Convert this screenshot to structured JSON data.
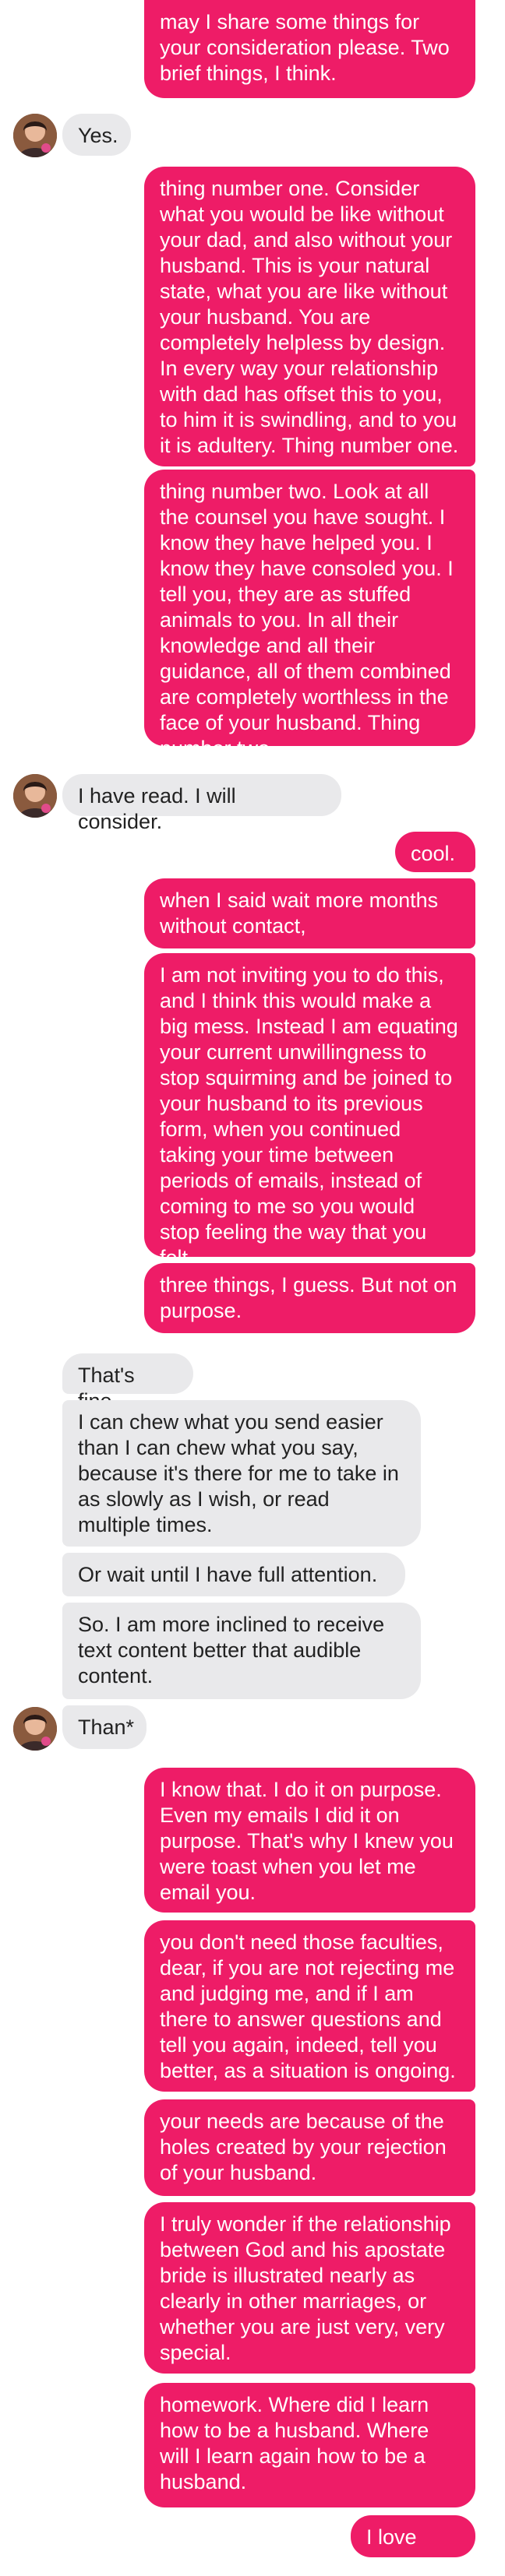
{
  "colors": {
    "outgoing_bubble": "#ee1c67",
    "outgoing_text": "#ffffff",
    "incoming_bubble": "#e9e9eb",
    "incoming_text": "#222222"
  },
  "avatar_icon": "profile-photo",
  "messages": [
    {
      "from": "me",
      "text": "may I share some things for your consideration please. Two brief things, I think."
    },
    {
      "from": "them",
      "text": "Yes."
    },
    {
      "from": "me",
      "text": "thing number one. Consider what you would be like without your dad, and also without your husband. This is your natural state, what you are like without your husband. You are completely helpless by design. In every way your relationship with dad has offset this to you, to him it is swindling, and to you it is adultery. Thing number one."
    },
    {
      "from": "me",
      "text": "thing number two. Look at all the counsel you have sought. I know they have helped you. I know they have consoled you. I tell you, they are as stuffed animals to you. In all their knowledge and all their guidance, all of them combined are completely worthless in the face of your husband. Thing number two."
    },
    {
      "from": "them",
      "text": "I have read. I will consider."
    },
    {
      "from": "me",
      "text": "cool."
    },
    {
      "from": "me",
      "text": "when I said wait more months without contact,"
    },
    {
      "from": "me",
      "text": "I am not inviting you to do this, and I think this would make a big mess. Instead I am equating your current unwillingness to stop squirming and be joined to your husband to its previous form, when you continued taking your time between periods of emails, instead of coming to me so you would stop feeling the way that you felt."
    },
    {
      "from": "me",
      "text": "three things, I guess. But not on purpose."
    },
    {
      "from": "them",
      "text": "That's fine."
    },
    {
      "from": "them",
      "text": "I can chew what you send easier than I can chew what you say, because it's there for me to take in as slowly as I wish, or read multiple times."
    },
    {
      "from": "them",
      "text": "Or wait until I have full attention."
    },
    {
      "from": "them",
      "text": "So. I am more inclined to receive text content better that audible content."
    },
    {
      "from": "them",
      "text": "Than*"
    },
    {
      "from": "me",
      "text": "I know that. I do it on purpose. Even my emails I did it on purpose. That's why I knew you were toast when you let me email you."
    },
    {
      "from": "me",
      "text": "you don't need those faculties, dear, if you are not rejecting me and judging me, and if I am there to answer questions and tell you again, indeed, tell you better, as a situation is ongoing."
    },
    {
      "from": "me",
      "text": "your needs are because of the holes created by your rejection of your husband."
    },
    {
      "from": "me",
      "text": "I truly wonder if the relationship between God and his apostate bride is illustrated nearly as clearly in other marriages, or whether you are just very, very special."
    },
    {
      "from": "me",
      "text": "homework. Where did I learn how to be a husband. Where will I learn again how to be a husband."
    },
    {
      "from": "me",
      "text": "I love you."
    }
  ]
}
